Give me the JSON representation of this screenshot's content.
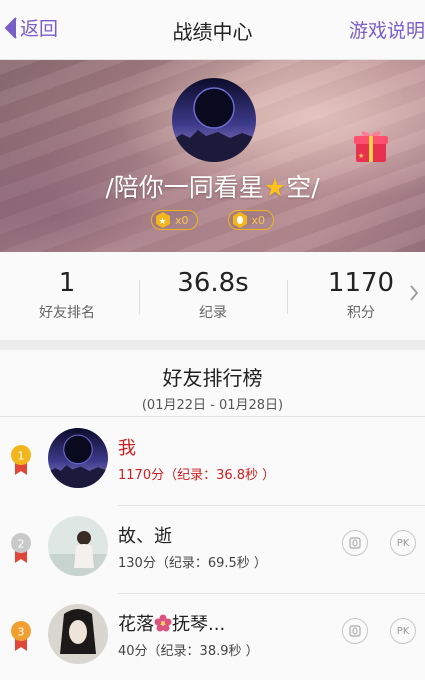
{
  "header": {
    "back_label": "返回",
    "title": "战绩中心",
    "help_label": "游戏说明"
  },
  "profile": {
    "nickname_prefix": "/陪你一同看星",
    "nickname_suffix": "空/",
    "star_glyph": "★",
    "badges": [
      {
        "icon": "star-coin-icon",
        "count": "x0"
      },
      {
        "icon": "egg-coin-icon",
        "count": "x0"
      }
    ],
    "gift_icon": "gift-box-icon"
  },
  "stats": [
    {
      "value": "1",
      "label": "好友排名"
    },
    {
      "value": "36.8s",
      "label": "纪录"
    },
    {
      "value": "1170",
      "label": "积分"
    }
  ],
  "leaderboard": {
    "title": "好友排行榜",
    "date_range": "(01月22日 - 01月28日)",
    "rows": [
      {
        "rank": "1",
        "name": "我",
        "detail": "1170分（纪录：36.8秒 ）"
      },
      {
        "rank": "2",
        "name": "故、逝",
        "detail": "130分（纪录：69.5秒 ）"
      },
      {
        "rank": "3",
        "name_prefix": "花落",
        "name_suffix": "抚琴...",
        "detail": "40分（纪录：38.9秒 ）"
      }
    ],
    "pk_label": "PK"
  },
  "colors": {
    "accent": "#7a5ec8",
    "me": "#cc1f1f",
    "gold": "#f2b51c"
  }
}
